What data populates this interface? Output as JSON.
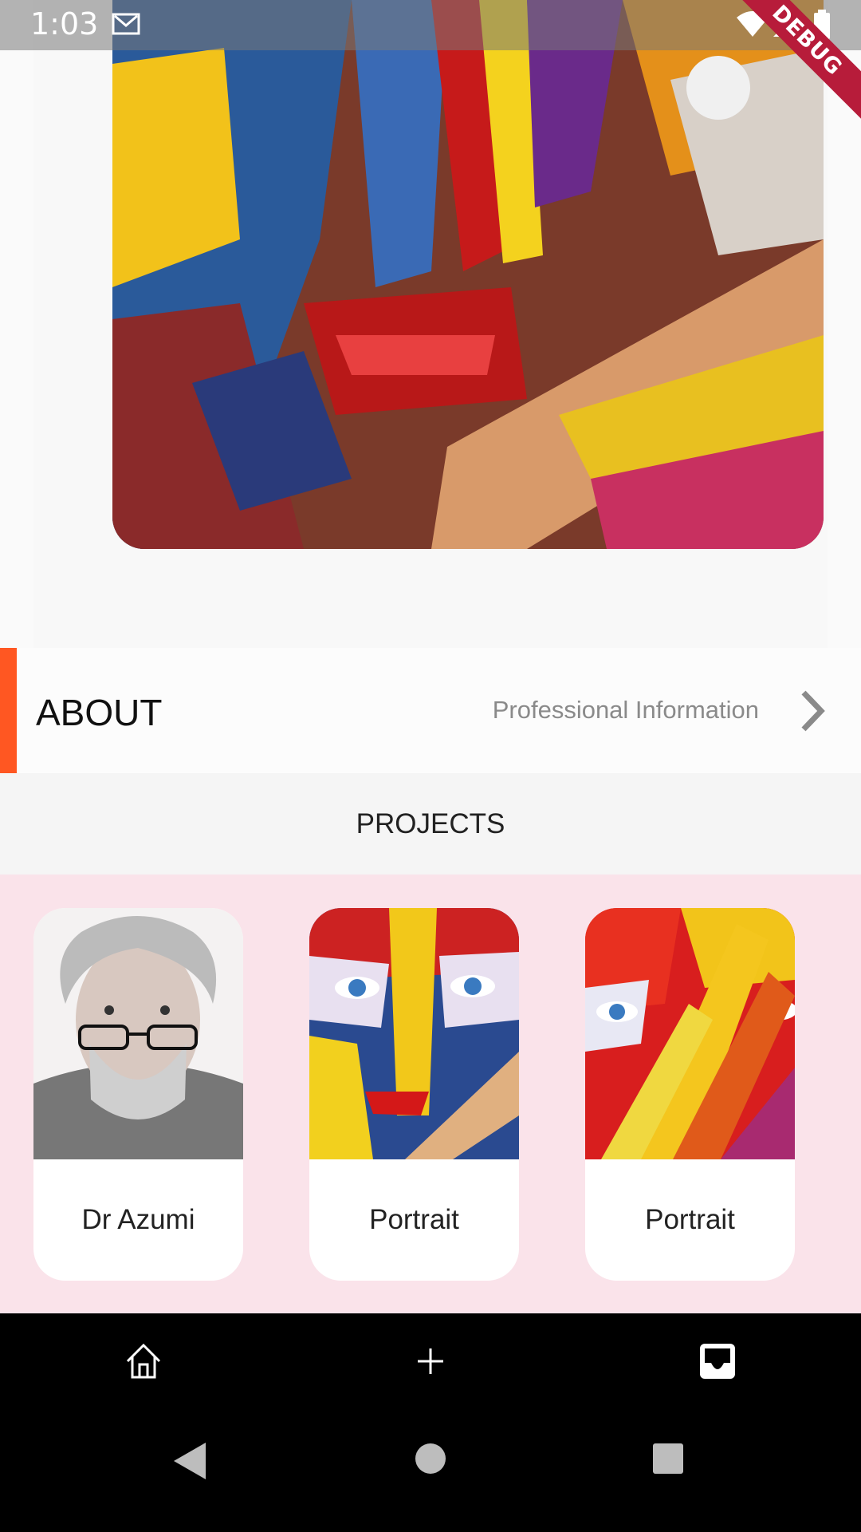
{
  "status_bar": {
    "time": "1:03",
    "debug_label": "DEBUG"
  },
  "about": {
    "title": "ABOUT",
    "subtitle": "Professional Information"
  },
  "projects": {
    "title": "PROJECTS",
    "cards": [
      {
        "label": "Dr Azumi",
        "image": "old-man-portrait"
      },
      {
        "label": "Portrait",
        "image": "painted-face-portrait"
      },
      {
        "label": "Portrait",
        "image": "painted-hand-portrait"
      }
    ]
  },
  "colors": {
    "accent": "#ff5722",
    "cards_background": "#fae3ea",
    "debug_ribbon": "#b71c3a"
  },
  "icons": {
    "nav": [
      "home-icon",
      "add-icon",
      "inbox-icon"
    ],
    "system": [
      "back-icon",
      "home-circle-icon",
      "recents-icon"
    ]
  }
}
